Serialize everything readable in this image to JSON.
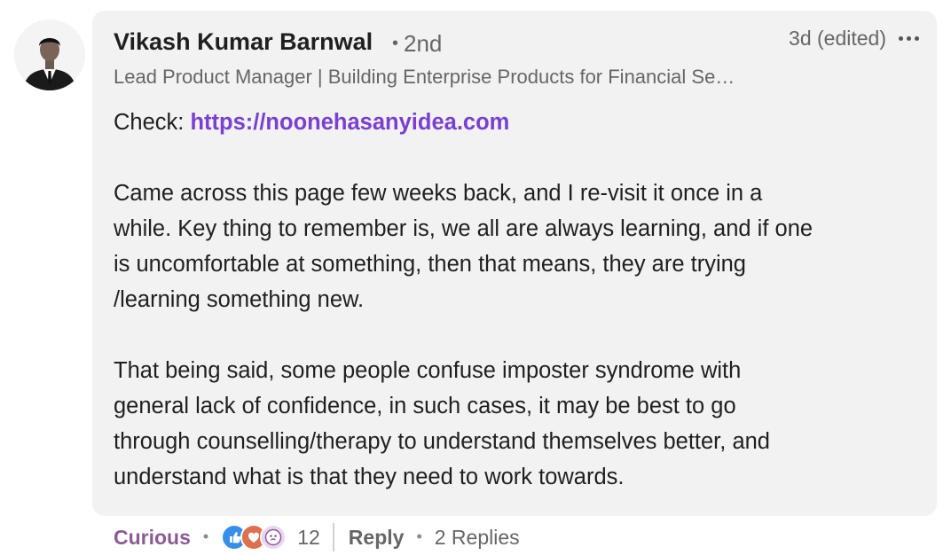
{
  "comment": {
    "author_name": "Vikash Kumar Barnwal",
    "connection_degree": "2nd",
    "timestamp": "3d (edited)",
    "headline": "Lead Product Manager | Building Enterprise Products for Financial Se…",
    "body": {
      "check_prefix": "Check: ",
      "link_text": "https://noonehasanyidea.com",
      "line1": "Came across this page few weeks back, and I re-visit it once in a",
      "line2": "while. Key thing to remember is, we all are always learning, and if one",
      "line3": "is uncomfortable at something, then that means, they are trying",
      "line4": "/learning something new.",
      "line5": "That being said, some people confuse imposter syndrome with",
      "line6": "general lack of confidence, in such cases, it may be best to go",
      "line7": "through counselling/therapy to understand themselves better, and",
      "line8": "understand what is that they need to work towards."
    }
  },
  "footer": {
    "reaction_label": "Curious",
    "reaction_icons": [
      "like-icon",
      "love-icon",
      "curious-icon"
    ],
    "reaction_count": "12",
    "reply_label": "Reply",
    "replies_label": "2 Replies"
  },
  "colors": {
    "bubble_bg": "#f2f2f2",
    "link": "#7b3fd1",
    "reaction_label": "#8b5b94",
    "muted_text": "#666666"
  }
}
